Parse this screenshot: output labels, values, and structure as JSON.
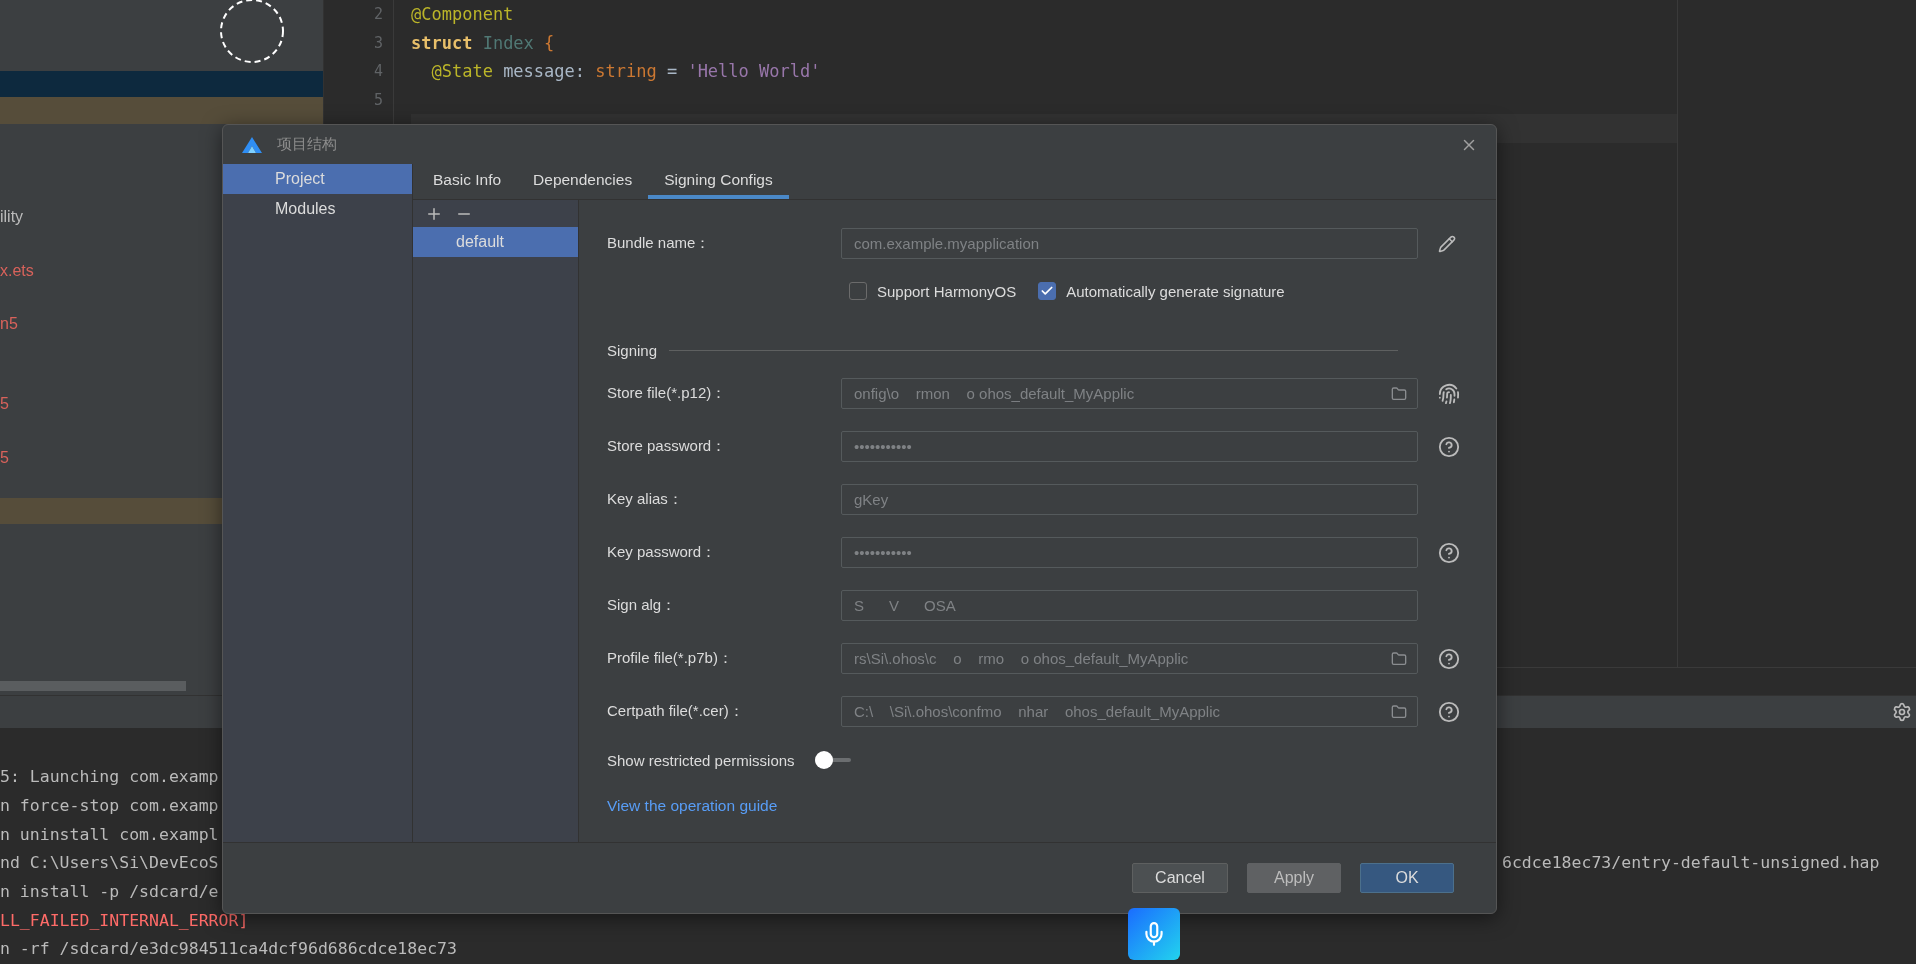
{
  "project_panel": {
    "rows": [
      {
        "kind": "blank",
        "selected": false,
        "marked": false
      },
      {
        "kind": "blank",
        "selected": true,
        "marked": false
      },
      {
        "kind": "blank",
        "selected": false,
        "marked": true
      },
      {
        "kind": "blank",
        "selected": false,
        "marked": false
      },
      {
        "kind": "blank",
        "selected": false,
        "marked": false
      },
      {
        "kind": "blank",
        "selected": false,
        "marked": false
      },
      {
        "kind": "file",
        "text": "ility",
        "error": false,
        "selected": false,
        "marked": false
      },
      {
        "kind": "blank",
        "selected": false,
        "marked": false
      },
      {
        "kind": "file",
        "text": "x.ets",
        "error": true,
        "selected": false,
        "marked": false
      },
      {
        "kind": "blank",
        "selected": false,
        "marked": false
      },
      {
        "kind": "file",
        "text": "n5",
        "error": true,
        "selected": false,
        "marked": false
      },
      {
        "kind": "blank",
        "selected": false,
        "marked": false
      },
      {
        "kind": "blank",
        "selected": false,
        "marked": false
      },
      {
        "kind": "file",
        "text": "5",
        "error": true,
        "selected": false,
        "marked": false
      },
      {
        "kind": "blank",
        "selected": false,
        "marked": false
      },
      {
        "kind": "file",
        "text": "5",
        "error": true,
        "selected": false,
        "marked": false
      },
      {
        "kind": "blank",
        "selected": false,
        "marked": false
      },
      {
        "kind": "blank",
        "selected": false,
        "marked": true
      }
    ]
  },
  "editor": {
    "lines": [
      {
        "number": "2",
        "tokens": [
          {
            "text": "@Component",
            "kind": "annotation"
          }
        ]
      },
      {
        "number": "3",
        "tokens": [
          {
            "text": "struct",
            "kind": "keyword"
          },
          {
            "text": " Index ",
            "kind": "type"
          },
          {
            "text": "{",
            "kind": "brace"
          }
        ]
      },
      {
        "number": "4",
        "tokens": [
          {
            "text": "  @State",
            "kind": "annotation"
          },
          {
            "text": " message: ",
            "kind": "plain"
          },
          {
            "text": "string",
            "kind": "typeword"
          },
          {
            "text": " = ",
            "kind": "plain"
          },
          {
            "text": "'Hello World'",
            "kind": "string"
          }
        ]
      },
      {
        "number": "5"
      }
    ]
  },
  "console": {
    "lines": [
      {
        "text": "5: Launching com.examp",
        "error": false
      },
      {
        "text": "n force-stop com.examp",
        "error": false
      },
      {
        "text": "n uninstall com.exampl",
        "error": false
      },
      {
        "text": "nd C:\\Users\\Si\\DevEcoS",
        "tail": "6cdce18ec73/entry-default-unsigned.hap",
        "error": false
      },
      {
        "text": "n install -p /sdcard/e",
        "error": false
      },
      {
        "text": "LL_FAILED_INTERNAL_ERROR]",
        "error": true
      },
      {
        "text": "n -rf /sdcard/e3dc984511ca4dcf96d686cdce18ec73",
        "error": false
      }
    ]
  },
  "dialog": {
    "title": "项目结构",
    "nav": [
      {
        "label": "Project",
        "selected": true
      },
      {
        "label": "Modules",
        "selected": false
      }
    ],
    "tabs": [
      {
        "label": "Basic Info",
        "selected": false
      },
      {
        "label": "Dependencies",
        "selected": false
      },
      {
        "label": "Signing Configs",
        "selected": true
      }
    ],
    "configs": [
      {
        "label": "default",
        "selected": true
      }
    ],
    "bundle": {
      "label": "Bundle name：",
      "value": "com.example.myapplication",
      "disabled": true
    },
    "options": [
      {
        "label": "Support HarmonyOS",
        "checked": false
      },
      {
        "label": "Automatically generate signature",
        "checked": true
      }
    ],
    "signing": {
      "title": "Signing",
      "fields": [
        {
          "label": "Store file(*.p12)：",
          "value": "onfig\\o    rmon    o ohos_default_MyApplic",
          "kind": "file",
          "fingerprint_button": true,
          "help_button": false,
          "disabled": true
        },
        {
          "label": "Store password：",
          "value": "•••••••••••",
          "kind": "password",
          "fingerprint_button": false,
          "help_button": true,
          "disabled": true
        },
        {
          "label": "Key alias：",
          "value": "gKey",
          "kind": "text",
          "fingerprint_button": false,
          "help_button": false,
          "disabled": true
        },
        {
          "label": "Key password：",
          "value": "•••••••••••",
          "kind": "password",
          "fingerprint_button": false,
          "help_button": true,
          "disabled": true
        },
        {
          "label": "Sign alg：",
          "value": "S      V      OSA",
          "kind": "text",
          "fingerprint_button": false,
          "help_button": false,
          "disabled": true
        },
        {
          "label": "Profile file(*.p7b)：",
          "value": "rs\\Si\\.ohos\\c    o    rmo    o ohos_default_MyApplic",
          "kind": "file",
          "fingerprint_button": false,
          "help_button": true,
          "disabled": true
        },
        {
          "label": "Certpath file(*.cer)：",
          "value": "C:\\    \\Si\\.ohos\\confmo    nhar    ohos_default_MyApplic",
          "kind": "file",
          "fingerprint_button": false,
          "help_button": true,
          "disabled": true
        }
      ]
    },
    "toggle": {
      "label": "Show restricted permissions",
      "on": false
    },
    "link": "View the operation guide",
    "buttons": [
      {
        "label": "Cancel",
        "kind": "default"
      },
      {
        "label": "Apply",
        "kind": "secondary"
      },
      {
        "label": "OK",
        "kind": "primary"
      }
    ]
  }
}
